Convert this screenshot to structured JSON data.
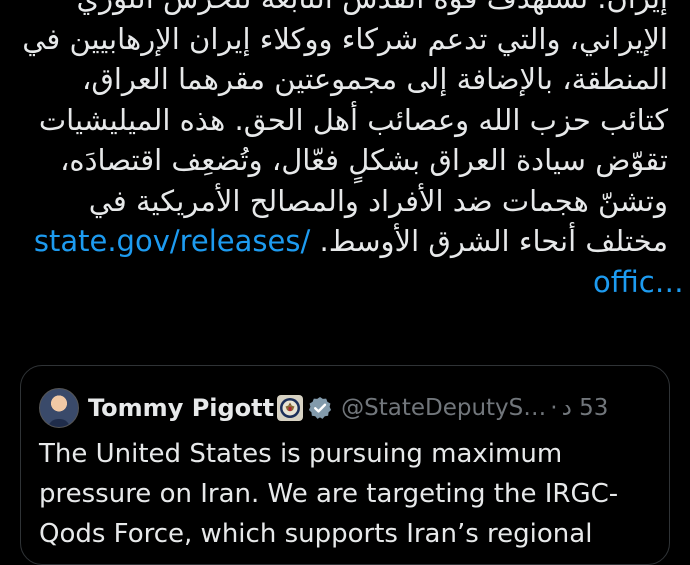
{
  "tweet": {
    "lines": [
      "إيران. تستهدف قوة القدس التابعة للحرس الثوري",
      "الإيراني، والتي تدعم شركاء ووكلاء إيران الإرهابيين في",
      "المنطقة، بالإضافة إلى مجموعتين مقرهما العراق،",
      "كتائب حزب الله وعصائب أهل الحق. هذه الميليشيات",
      "تقوّض سيادة العراق بشكلٍ فعّال، وتُضعِف اقتصادَه،",
      "وتشنّ هجمات ضد الأفراد والمصالح الأمريكية في"
    ],
    "last_line_text": "مختلف أنحاء الشرق الأوسط.",
    "link_part1": "state.gov/releases/",
    "link_part2": "offic…"
  },
  "quote": {
    "display_name": "Tommy Pigott",
    "handle": "@StateDeputyS…",
    "separator": "·",
    "time": "53 د",
    "lines": [
      "The United States is pursuing maximum",
      "pressure on Iran. We are targeting the IRGC-",
      "Qods Force, which supports Iran’s regional"
    ]
  },
  "colors": {
    "background": "#000000",
    "text": "#e7e9ea",
    "secondary_text": "#71767b",
    "link": "#1d9bf0",
    "border": "#2f3336",
    "verified_gray": "#829aab"
  },
  "icons": {
    "seal": "us-state-department-seal-icon",
    "verified": "gray-verified-badge-icon"
  }
}
